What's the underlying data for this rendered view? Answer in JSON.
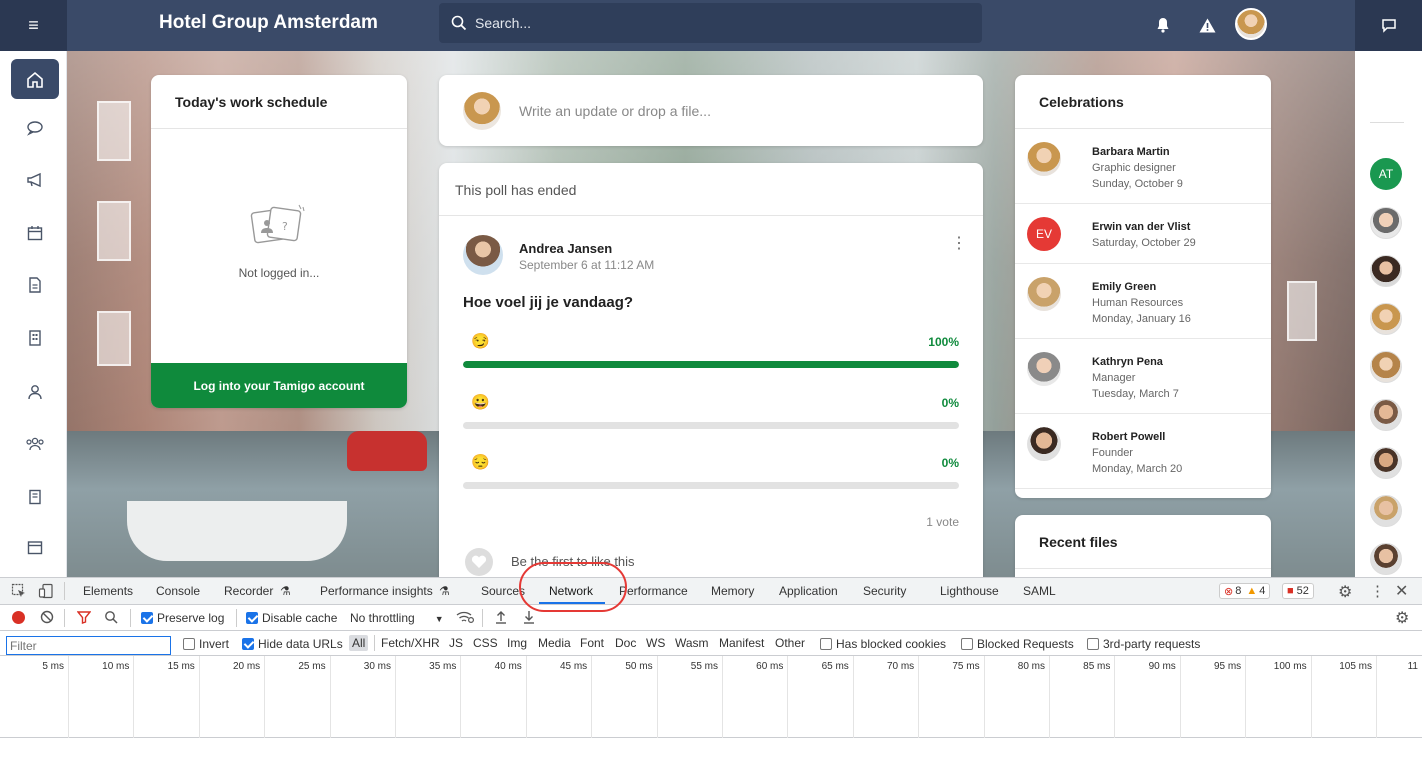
{
  "app": {
    "title": "Hotel Group Amsterdam"
  },
  "search": {
    "placeholder": "Search..."
  },
  "icons": {
    "menu": "hamburger-icon",
    "bell": "bell-icon",
    "warning": "warning-icon",
    "chat": "chat-icon"
  },
  "schedule": {
    "title": "Today's work schedule",
    "status": "Not logged in...",
    "login_label": "Log into your Tamigo account"
  },
  "composer": {
    "placeholder": "Write an update or drop a file..."
  },
  "poll": {
    "status": "This poll has ended",
    "author": "Andrea Jansen",
    "date": "September 6 at 11:12 AM",
    "question": "Hoe voel jij je vandaag?",
    "options": [
      {
        "emoji": "😏",
        "percent_label": "100%",
        "percent": 100
      },
      {
        "emoji": "😀",
        "percent_label": "0%",
        "percent": 0
      },
      {
        "emoji": "😔",
        "percent_label": "0%",
        "percent": 0
      }
    ],
    "votes": "1 vote",
    "like_text": "Be the first to like this"
  },
  "celebrations": {
    "title": "Celebrations",
    "items": [
      {
        "name": "Barbara Martin",
        "role": "Graphic designer",
        "date": "Sunday, October 9"
      },
      {
        "name": "Erwin van der Vlist",
        "initials": "EV",
        "date": "Saturday, October 29"
      },
      {
        "name": "Emily Green",
        "role": "Human Resources",
        "date": "Monday, January 16"
      },
      {
        "name": "Kathryn Pena",
        "role": "Manager",
        "date": "Tuesday, March 7"
      },
      {
        "name": "Robert Powell",
        "role": "Founder",
        "date": "Monday, March 20"
      }
    ]
  },
  "recent_files": {
    "title": "Recent files"
  },
  "right_rail": {
    "first_initials": "AT"
  },
  "devtools": {
    "tabs": [
      "Elements",
      "Console",
      "Recorder",
      "Performance insights",
      "Sources",
      "Network",
      "Performance",
      "Memory",
      "Application",
      "Security",
      "Lighthouse",
      "SAML"
    ],
    "active_tab": "Network",
    "errors": "8",
    "warnings": "4",
    "issues": "52",
    "preserve_log": "Preserve log",
    "disable_cache": "Disable cache",
    "throttling": "No throttling",
    "filter_placeholder": "Filter",
    "invert": "Invert",
    "hide_data_urls": "Hide data URLs",
    "types": [
      "All",
      "Fetch/XHR",
      "JS",
      "CSS",
      "Img",
      "Media",
      "Font",
      "Doc",
      "WS",
      "Wasm",
      "Manifest",
      "Other"
    ],
    "has_blocked_cookies": "Has blocked cookies",
    "blocked_requests": "Blocked Requests",
    "third_party": "3rd-party requests",
    "timeline_ticks": [
      "5 ms",
      "10 ms",
      "15 ms",
      "20 ms",
      "25 ms",
      "30 ms",
      "35 ms",
      "40 ms",
      "45 ms",
      "50 ms",
      "55 ms",
      "60 ms",
      "65 ms",
      "70 ms",
      "75 ms",
      "80 ms",
      "85 ms",
      "90 ms",
      "95 ms",
      "100 ms",
      "105 ms",
      "11"
    ]
  }
}
